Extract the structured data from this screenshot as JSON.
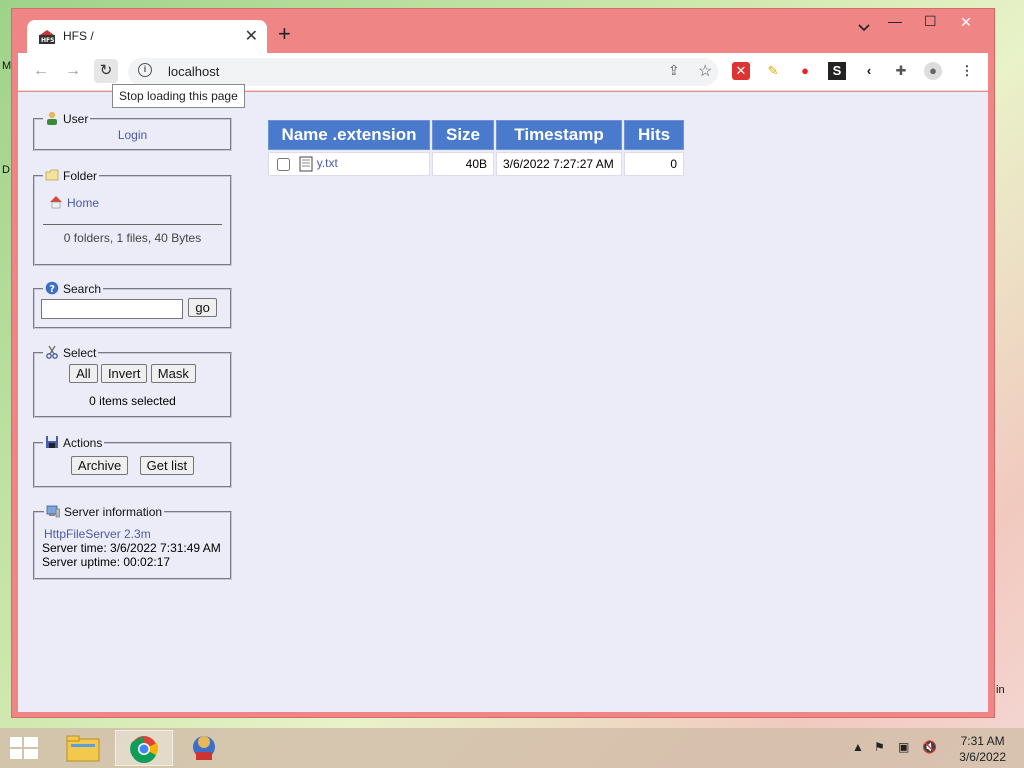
{
  "desktop": {
    "frag_top": "M",
    "frag_mid": "D",
    "frag_bottom": "in"
  },
  "browser": {
    "tab_title": "HFS /",
    "tab_close": "✕",
    "new_tab": "+",
    "url": "localhost",
    "tooltip": "Stop loading this page",
    "minimize": "—",
    "maximize": "☐",
    "close": "✕"
  },
  "sidebar": {
    "user": {
      "legend": "User",
      "login": "Login"
    },
    "folder": {
      "legend": "Folder",
      "home": "Home",
      "summary": "0 folders, 1 files, 40 Bytes"
    },
    "search": {
      "legend": "Search",
      "placeholder": "",
      "go": "go"
    },
    "select": {
      "legend": "Select",
      "all": "All",
      "invert": "Invert",
      "mask": "Mask",
      "status": "0 items selected"
    },
    "actions": {
      "legend": "Actions",
      "archive": "Archive",
      "get_list": "Get list"
    },
    "server": {
      "legend": "Server information",
      "software": "HttpFileServer 2.3m",
      "time": "Server time: 3/6/2022 7:31:49 AM",
      "uptime": "Server uptime: 00:02:17"
    }
  },
  "file_table": {
    "headers": {
      "name": "Name .extension",
      "size": "Size",
      "timestamp": "Timestamp",
      "hits": "Hits"
    },
    "rows": [
      {
        "name": "y.txt",
        "size": "40B",
        "timestamp": "3/6/2022 7:27:27 AM",
        "hits": "0"
      }
    ]
  },
  "taskbar": {
    "time": "7:31 AM",
    "date": "3/6/2022"
  },
  "colors": {
    "tab_bar": "#f08585",
    "table_header": "#4a7acb",
    "page_bg": "#ececf9",
    "link": "#4a5aa8"
  }
}
